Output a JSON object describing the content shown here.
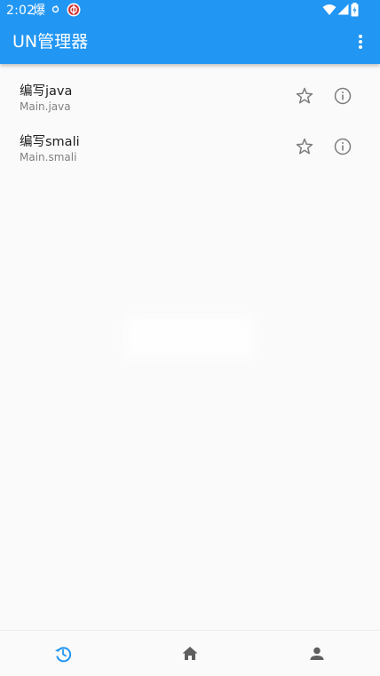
{
  "status_bar": {
    "time": "2:02",
    "notif_char": "爆"
  },
  "toolbar": {
    "title": "UN管理器"
  },
  "files": [
    {
      "title": "编写java",
      "subtitle": "Main.java"
    },
    {
      "title": "编写smali",
      "subtitle": "Main.smali"
    }
  ],
  "bottom_nav": {
    "active": "history",
    "items": [
      "history",
      "home",
      "profile"
    ]
  },
  "colors": {
    "primary": "#2196f3",
    "icon_gray": "#7d7d7d",
    "nav_gray": "#5f5f5f",
    "background": "#fafafa"
  }
}
